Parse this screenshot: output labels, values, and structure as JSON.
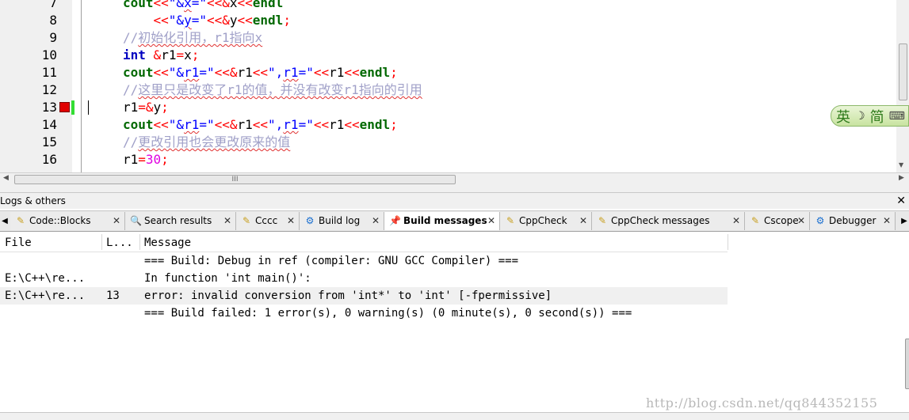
{
  "editor": {
    "line_numbers": [
      "7",
      "8",
      "9",
      "10",
      "11",
      "12",
      "13",
      "14",
      "15",
      "16"
    ],
    "lines": [
      [
        {
          "t": "cout",
          "c": "io"
        },
        {
          "t": "<<",
          "c": "op"
        },
        {
          "t": "\"&",
          "c": "str"
        },
        {
          "t": "x",
          "c": "str sq"
        },
        {
          "t": "=\"",
          "c": "str"
        },
        {
          "t": "<<&",
          "c": "op"
        },
        {
          "t": "x",
          "c": ""
        },
        {
          "t": "<<",
          "c": "op"
        },
        {
          "t": "endl",
          "c": "io"
        }
      ],
      [
        {
          "t": "    ",
          "c": ""
        },
        {
          "t": "<<",
          "c": "op"
        },
        {
          "t": "\"&",
          "c": "str"
        },
        {
          "t": "y",
          "c": "str sq"
        },
        {
          "t": "=\"",
          "c": "str"
        },
        {
          "t": "<<&",
          "c": "op"
        },
        {
          "t": "y",
          "c": ""
        },
        {
          "t": "<<",
          "c": "op"
        },
        {
          "t": "endl",
          "c": "io"
        },
        {
          "t": ";",
          "c": "op"
        }
      ],
      [
        {
          "t": "//",
          "c": "cmt"
        },
        {
          "t": "初始化引用，r1指向x",
          "c": "cmt sq"
        }
      ],
      [
        {
          "t": "int",
          "c": "kw"
        },
        {
          "t": " ",
          "c": ""
        },
        {
          "t": "&",
          "c": "op"
        },
        {
          "t": "r1",
          "c": ""
        },
        {
          "t": "=",
          "c": "op"
        },
        {
          "t": "x",
          "c": ""
        },
        {
          "t": ";",
          "c": "op"
        }
      ],
      [
        {
          "t": "cout",
          "c": "io"
        },
        {
          "t": "<<",
          "c": "op"
        },
        {
          "t": "\"&",
          "c": "str"
        },
        {
          "t": "r1",
          "c": "str sq"
        },
        {
          "t": "=\"",
          "c": "str"
        },
        {
          "t": "<<&",
          "c": "op"
        },
        {
          "t": "r1",
          "c": ""
        },
        {
          "t": "<<",
          "c": "op"
        },
        {
          "t": "\",",
          "c": "str"
        },
        {
          "t": "r1",
          "c": "str sq"
        },
        {
          "t": "=\"",
          "c": "str"
        },
        {
          "t": "<<",
          "c": "op"
        },
        {
          "t": "r1",
          "c": ""
        },
        {
          "t": "<<",
          "c": "op"
        },
        {
          "t": "endl",
          "c": "io"
        },
        {
          "t": ";",
          "c": "op"
        }
      ],
      [
        {
          "t": "//",
          "c": "cmt"
        },
        {
          "t": "这里只是改变了r1的值，并没有改变r1指向的引用",
          "c": "cmt sq"
        }
      ],
      [
        {
          "t": "r1",
          "c": ""
        },
        {
          "t": "=&",
          "c": "op"
        },
        {
          "t": "y",
          "c": ""
        },
        {
          "t": ";",
          "c": "op"
        }
      ],
      [
        {
          "t": "cout",
          "c": "io"
        },
        {
          "t": "<<",
          "c": "op"
        },
        {
          "t": "\"&",
          "c": "str"
        },
        {
          "t": "r1",
          "c": "str sq"
        },
        {
          "t": "=\"",
          "c": "str"
        },
        {
          "t": "<<&",
          "c": "op"
        },
        {
          "t": "r1",
          "c": ""
        },
        {
          "t": "<<",
          "c": "op"
        },
        {
          "t": "\",",
          "c": "str"
        },
        {
          "t": "r1",
          "c": "str sq"
        },
        {
          "t": "=\"",
          "c": "str"
        },
        {
          "t": "<<",
          "c": "op"
        },
        {
          "t": "r1",
          "c": ""
        },
        {
          "t": "<<",
          "c": "op"
        },
        {
          "t": "endl",
          "c": "io"
        },
        {
          "t": ";",
          "c": "op"
        }
      ],
      [
        {
          "t": "//",
          "c": "cmt"
        },
        {
          "t": "更改引用也会更改原来的值",
          "c": "cmt sq"
        }
      ],
      [
        {
          "t": "r1",
          "c": ""
        },
        {
          "t": "=",
          "c": "op"
        },
        {
          "t": "30",
          "c": "num"
        },
        {
          "t": ";",
          "c": "op"
        }
      ]
    ],
    "breakpoint_line": "13",
    "hscroll_grip": "III"
  },
  "ime": {
    "lang": "英",
    "moon": "☽",
    "mode": "简",
    "kbd": "⌨"
  },
  "panel": {
    "title": "Logs & others",
    "close": "✕",
    "tabs": [
      {
        "label": "Code::Blocks",
        "icon": "notepad-icon",
        "active": false
      },
      {
        "label": "Search results",
        "icon": "search-icon",
        "active": false
      },
      {
        "label": "Cccc",
        "icon": "notepad-icon",
        "active": false
      },
      {
        "label": "Build log",
        "icon": "gear-icon",
        "active": false
      },
      {
        "label": "Build messages",
        "icon": "pin-icon",
        "active": true
      },
      {
        "label": "CppCheck",
        "icon": "notepad-icon",
        "active": false
      },
      {
        "label": "CppCheck messages",
        "icon": "notepad-icon",
        "active": false
      },
      {
        "label": "Cscope",
        "icon": "notepad-icon",
        "active": false
      },
      {
        "label": "Debugger",
        "icon": "gear-icon",
        "active": false
      }
    ],
    "tab_close": "✕"
  },
  "messages": {
    "headers": {
      "file": "File",
      "line": "L...",
      "message": "Message"
    },
    "rows": [
      {
        "file": "",
        "line": "",
        "message": "=== Build: Debug in ref (compiler: GNU GCC Compiler) ===",
        "selected": false
      },
      {
        "file": "E:\\C++\\re...",
        "line": "",
        "message": "In function 'int main()':",
        "selected": false
      },
      {
        "file": "E:\\C++\\re...",
        "line": "13",
        "message": "error: invalid conversion from 'int*' to 'int' [-fpermissive]",
        "selected": true
      },
      {
        "file": "",
        "line": "",
        "message": "=== Build failed: 1 error(s), 0 warning(s) (0 minute(s), 0 second(s)) ===",
        "selected": false
      }
    ]
  },
  "watermark": "http://blog.csdn.net/qq844352155"
}
